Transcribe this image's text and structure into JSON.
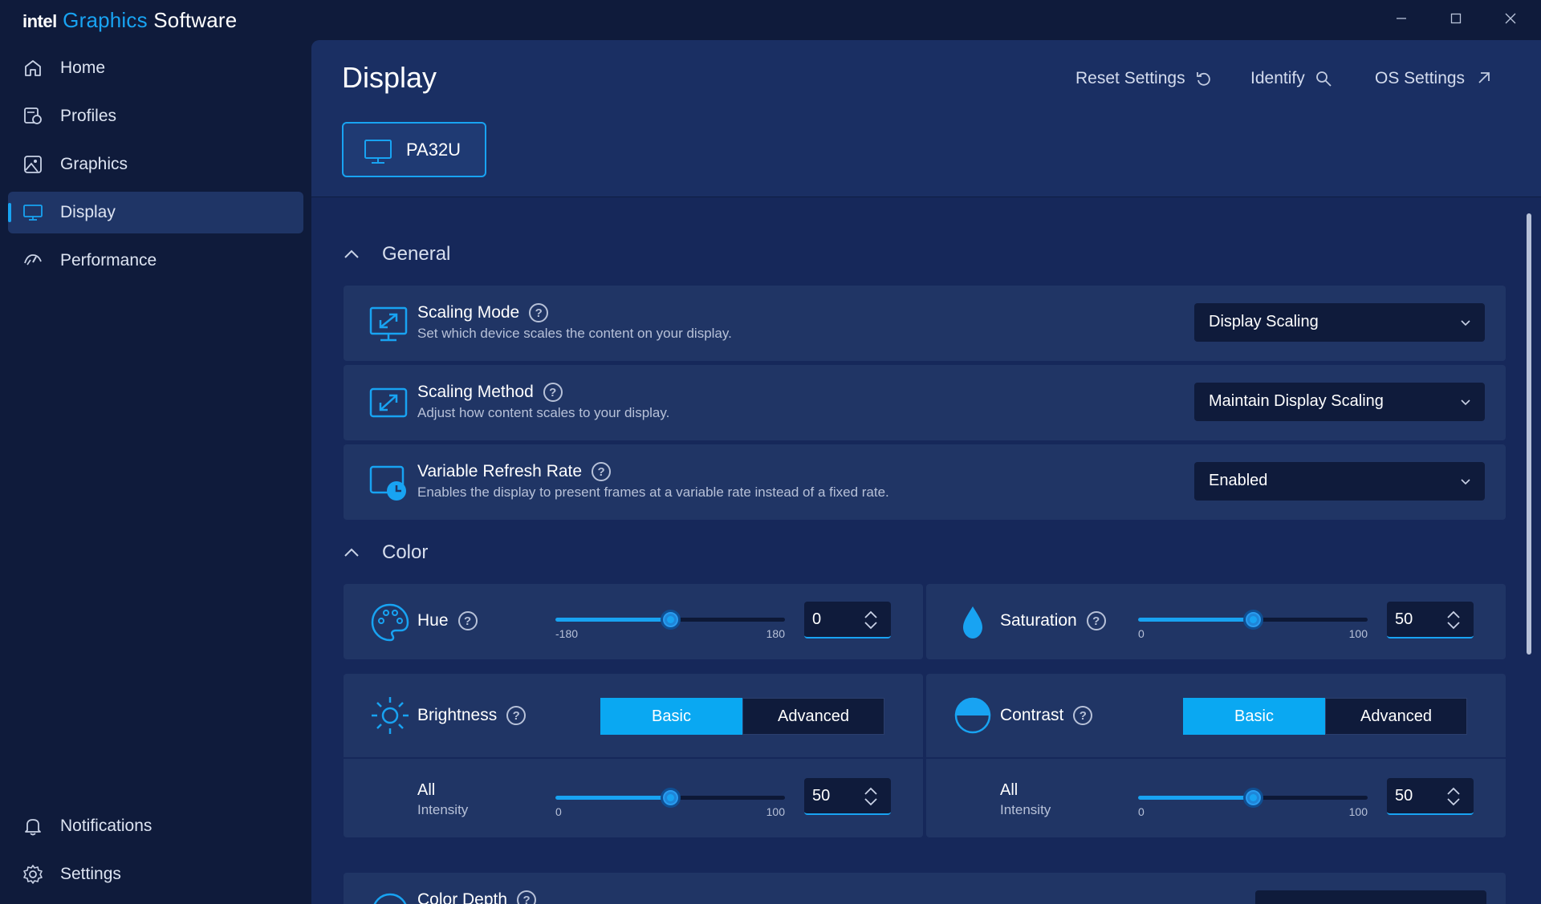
{
  "app": {
    "brand_intel": "intel",
    "brand_graphics": "Graphics",
    "brand_software": "Software"
  },
  "sidebar": {
    "items": [
      {
        "label": "Home",
        "icon": "home-icon"
      },
      {
        "label": "Profiles",
        "icon": "profiles-icon"
      },
      {
        "label": "Graphics",
        "icon": "graphics-icon"
      },
      {
        "label": "Display",
        "icon": "display-icon",
        "active": true
      },
      {
        "label": "Performance",
        "icon": "performance-icon"
      }
    ],
    "bottom_items": [
      {
        "label": "Notifications",
        "icon": "bell-icon"
      },
      {
        "label": "Settings",
        "icon": "gear-icon"
      }
    ]
  },
  "header": {
    "title": "Display",
    "reset_label": "Reset Settings",
    "identify_label": "Identify",
    "os_settings_label": "OS Settings",
    "monitor_tab": "PA32U"
  },
  "general": {
    "heading": "General",
    "rows": [
      {
        "title": "Scaling Mode",
        "desc": "Set which device scales the content on your display.",
        "value": "Display Scaling"
      },
      {
        "title": "Scaling Method",
        "desc": "Adjust how content scales to your display.",
        "value": "Maintain Display Scaling"
      },
      {
        "title": "Variable Refresh Rate",
        "desc": "Enables the display to present frames at a variable rate instead of a fixed rate.",
        "value": "Enabled"
      }
    ]
  },
  "color": {
    "heading": "Color",
    "hue": {
      "title": "Hue",
      "min": "-180",
      "max": "180",
      "value": "0",
      "fraction": 0.5
    },
    "saturation": {
      "title": "Saturation",
      "min": "0",
      "max": "100",
      "value": "50",
      "fraction": 0.5
    },
    "brightness": {
      "title": "Brightness",
      "basic": "Basic",
      "advanced": "Advanced",
      "sub_label": "All",
      "sub_desc": "Intensity",
      "min": "0",
      "max": "100",
      "value": "50",
      "fraction": 0.5
    },
    "contrast": {
      "title": "Contrast",
      "basic": "Basic",
      "advanced": "Advanced",
      "sub_label": "All",
      "sub_desc": "Intensity",
      "min": "0",
      "max": "100",
      "value": "50",
      "fraction": 0.5
    },
    "color_depth": {
      "title": "Color Depth"
    }
  },
  "colors": {
    "accent": "#18a3f2",
    "background": "#0f1b3b",
    "panel": "#16285a",
    "card": "#203565"
  }
}
